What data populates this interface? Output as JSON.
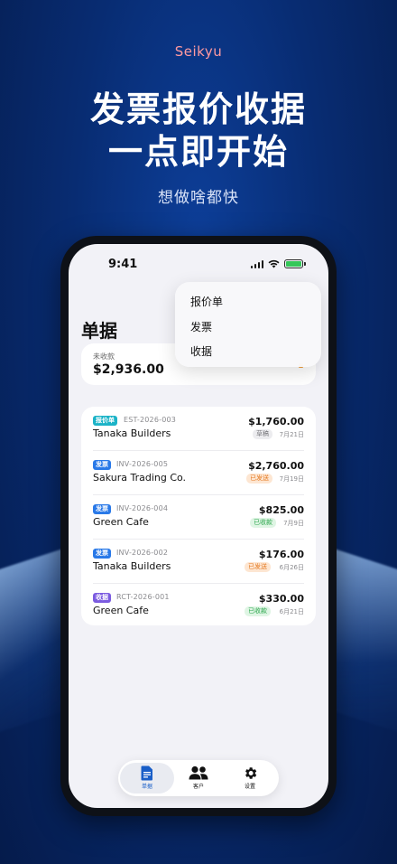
{
  "promo": {
    "brand": "Seikyu",
    "headline_line1": "发票报价收据",
    "headline_line2": "一点即开始",
    "subtitle": "想做啥都快"
  },
  "status_bar": {
    "time": "9:41"
  },
  "screen": {
    "title": "单据",
    "summary": {
      "label": "未收款",
      "amount": "$2,936.00"
    },
    "menu": {
      "items": [
        "报价单",
        "发票",
        "收据"
      ]
    },
    "documents": [
      {
        "type": "报价单",
        "type_color": "#1bb3c7",
        "number": "EST-2026-003",
        "client": "Tanaka Builders",
        "amount": "$1,760.00",
        "status": "草稿",
        "status_bg": "#ececef",
        "status_fg": "#7a7a7e",
        "date": "7月21日"
      },
      {
        "type": "发票",
        "type_color": "#2979e8",
        "number": "INV-2026-005",
        "client": "Sakura Trading Co.",
        "amount": "$2,760.00",
        "status": "已发送",
        "status_bg": "#fde6d2",
        "status_fg": "#e57a22",
        "date": "7月19日"
      },
      {
        "type": "发票",
        "type_color": "#2979e8",
        "number": "INV-2026-004",
        "client": "Green Cafe",
        "amount": "$825.00",
        "status": "已收款",
        "status_bg": "#dff5e4",
        "status_fg": "#2fa84f",
        "date": "7月9日"
      },
      {
        "type": "发票",
        "type_color": "#2979e8",
        "number": "INV-2026-002",
        "client": "Tanaka Builders",
        "amount": "$176.00",
        "status": "已发送",
        "status_bg": "#fde6d2",
        "status_fg": "#e57a22",
        "date": "6月26日"
      },
      {
        "type": "收据",
        "type_color": "#7b5be0",
        "number": "RCT-2026-001",
        "client": "Green Cafe",
        "amount": "$330.00",
        "status": "已收款",
        "status_bg": "#dff5e4",
        "status_fg": "#2fa84f",
        "date": "6月21日"
      }
    ],
    "tabbar": {
      "items": [
        {
          "label": "单据",
          "icon": "document-icon",
          "active": true
        },
        {
          "label": "客户",
          "icon": "people-icon",
          "active": false
        },
        {
          "label": "设置",
          "icon": "gear-icon",
          "active": false
        }
      ]
    }
  }
}
